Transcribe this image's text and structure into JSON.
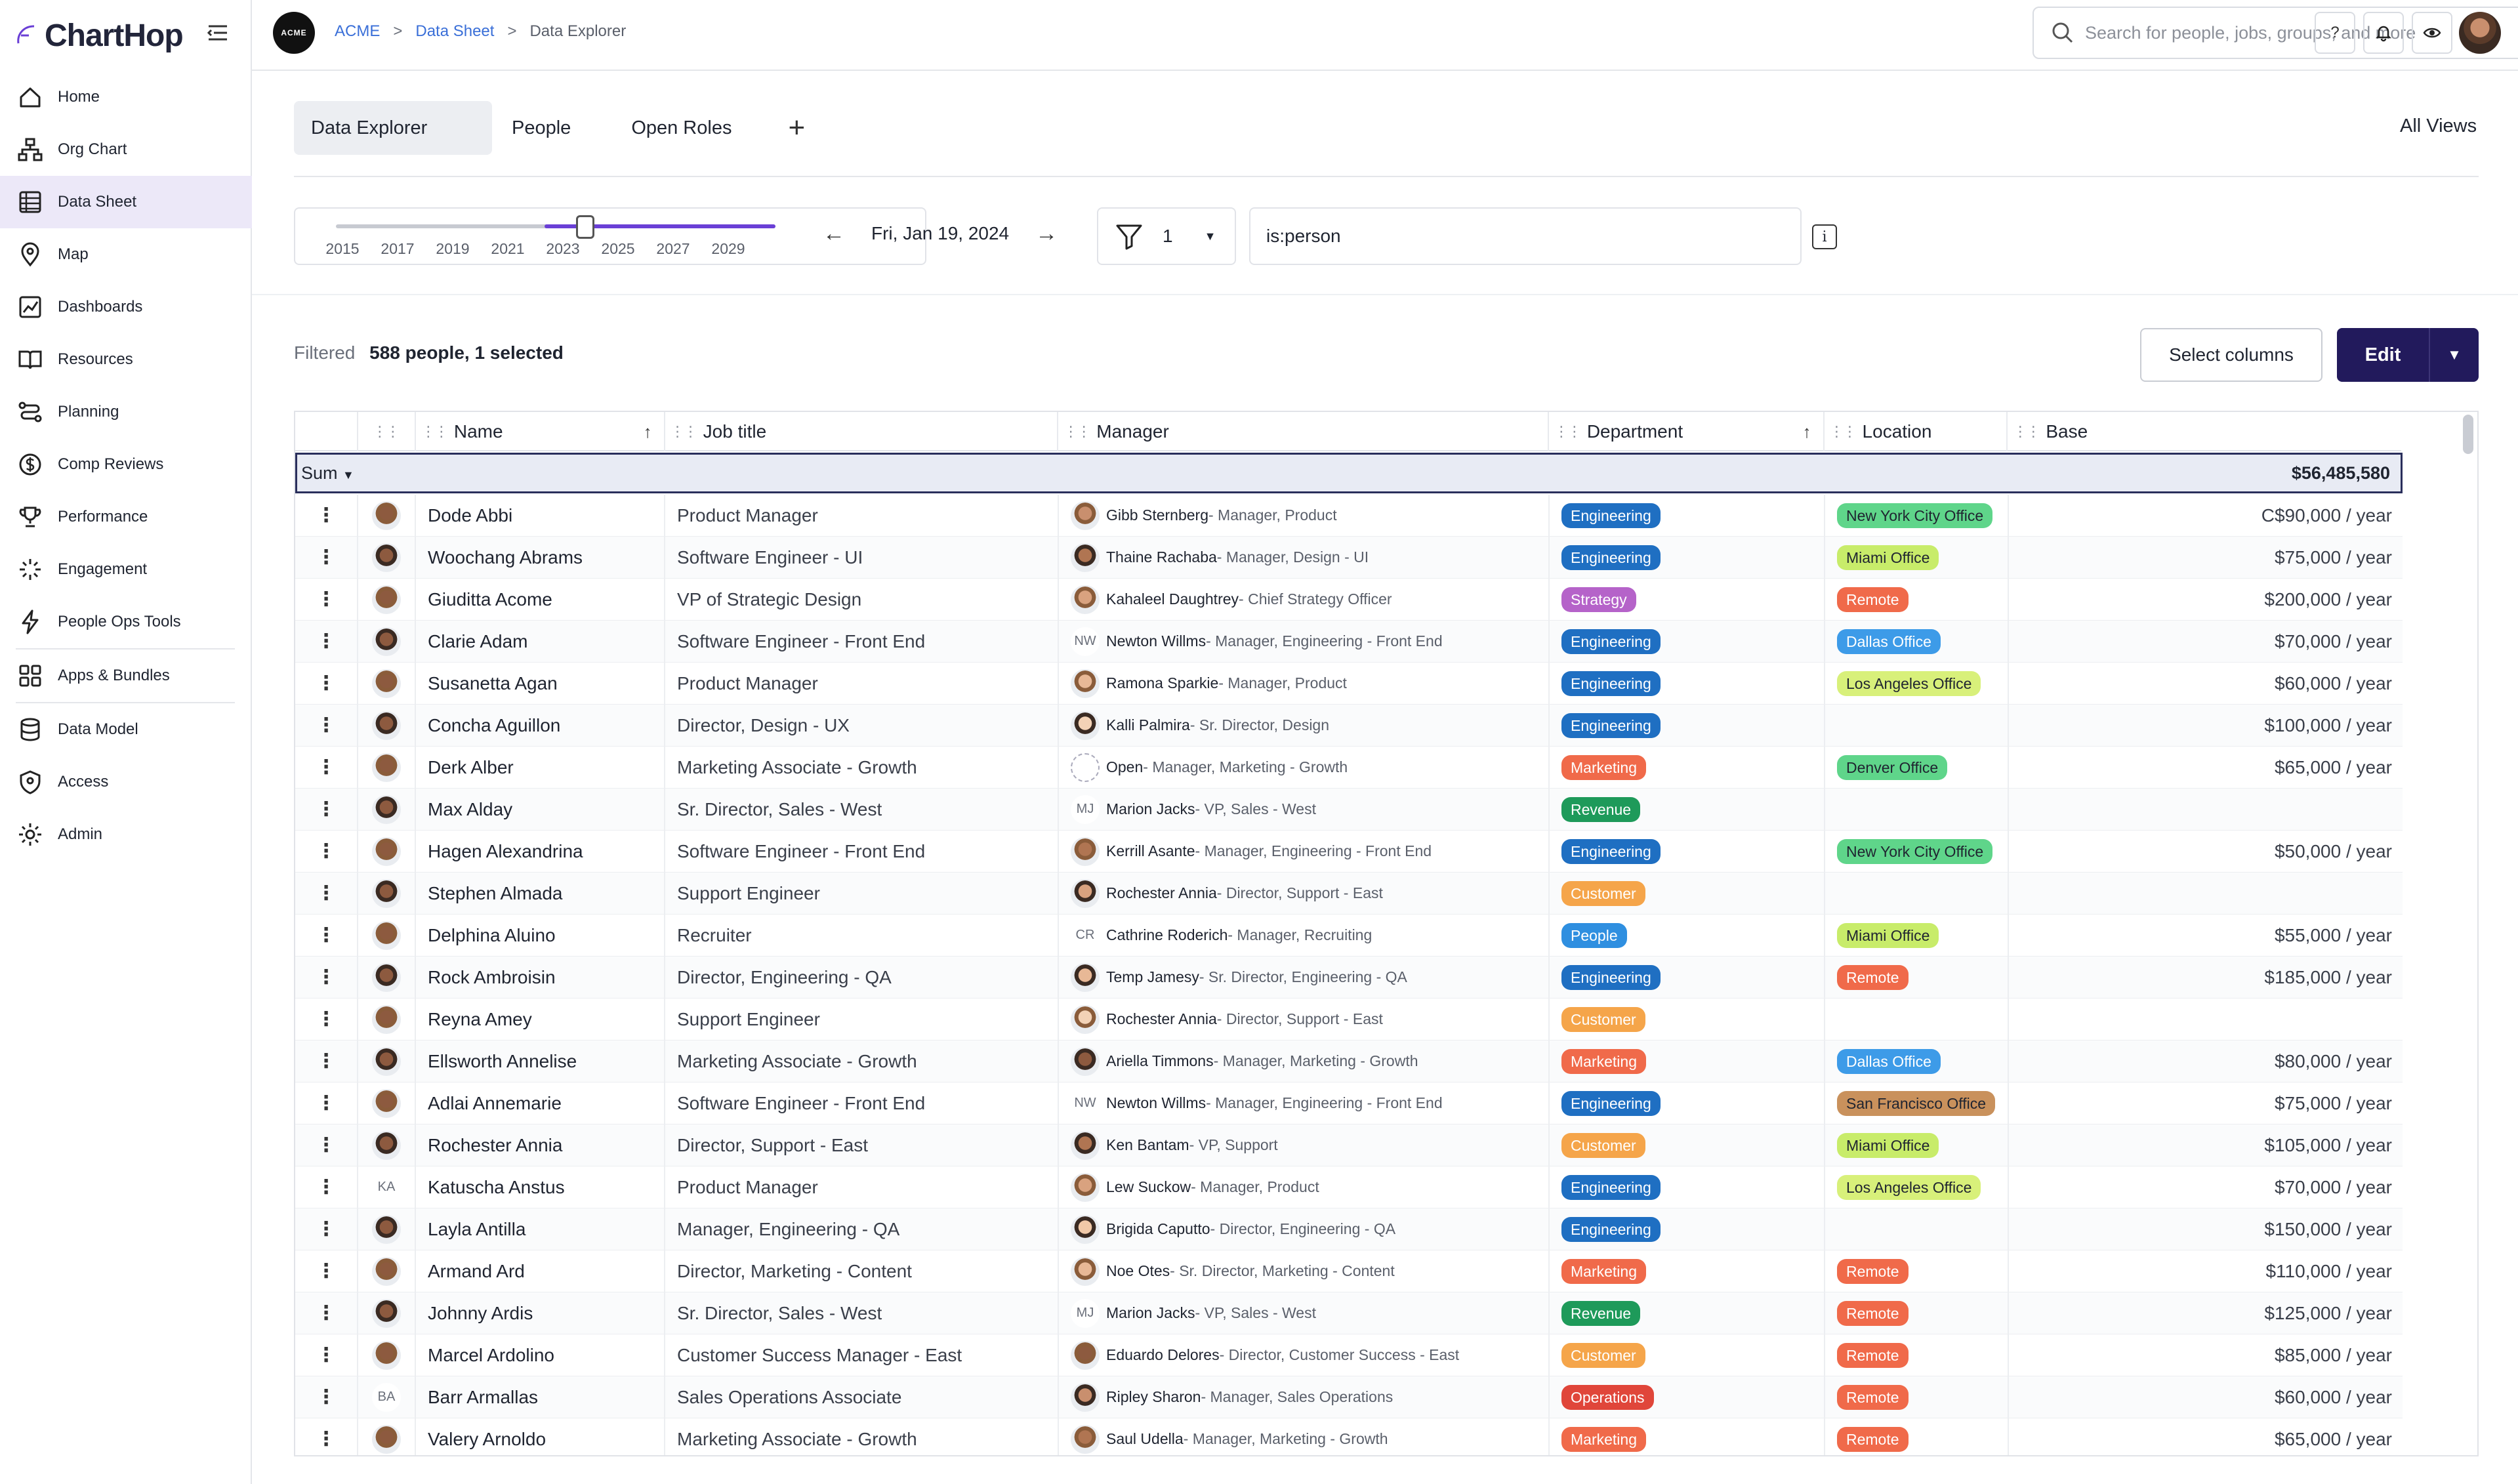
{
  "app": {
    "name": "ChartHop"
  },
  "sidebar": {
    "items": [
      {
        "label": "Home",
        "icon": "home-icon"
      },
      {
        "label": "Org Chart",
        "icon": "org-chart-icon"
      },
      {
        "label": "Data Sheet",
        "icon": "data-sheet-icon",
        "active": true
      },
      {
        "label": "Map",
        "icon": "map-pin-icon"
      },
      {
        "label": "Dashboards",
        "icon": "dashboard-icon"
      },
      {
        "label": "Resources",
        "icon": "book-icon"
      },
      {
        "label": "Planning",
        "icon": "planning-icon"
      },
      {
        "label": "Comp Reviews",
        "icon": "dollar-icon"
      },
      {
        "label": "Performance",
        "icon": "trophy-icon"
      },
      {
        "label": "Engagement",
        "icon": "engagement-icon"
      },
      {
        "label": "People Ops Tools",
        "icon": "bolt-icon"
      },
      {
        "label": "Apps & Bundles",
        "icon": "apps-icon"
      },
      {
        "label": "Data Model",
        "icon": "database-icon"
      },
      {
        "label": "Access",
        "icon": "shield-icon"
      },
      {
        "label": "Admin",
        "icon": "gear-icon"
      }
    ]
  },
  "topbar": {
    "org_logo": "ACME",
    "breadcrumb": [
      "ACME",
      "Data Sheet",
      "Data Explorer"
    ],
    "search_placeholder": "Search for people, jobs, groups, and more",
    "help": "?"
  },
  "tabs": [
    "Data Explorer",
    "People",
    "Open Roles"
  ],
  "all_views": "All Views",
  "timeline": {
    "years": [
      "2015",
      "2017",
      "2019",
      "2021",
      "2023",
      "2025",
      "2027",
      "2029"
    ],
    "date": "Fri, Jan 19, 2024"
  },
  "filter": {
    "count": "1",
    "query": "is:person"
  },
  "summary": {
    "label": "Filtered",
    "value": "588 people, 1 selected"
  },
  "actions": {
    "select_columns": "Select columns",
    "edit": "Edit"
  },
  "table": {
    "columns": [
      "Name",
      "Job title",
      "Manager",
      "Department",
      "Location",
      "Base"
    ],
    "sum_label": "Sum",
    "sum_value": "$56,485,580",
    "rows": [
      {
        "name": "Dode Abbi",
        "job": "Product Manager",
        "mgr": "Gibb Sternberg",
        "mgr_title": " - Manager, Product",
        "dept": "Engineering",
        "loc": "New York City Office",
        "base": "C$90,000 / year"
      },
      {
        "name": "Woochang Abrams",
        "job": "Software Engineer - UI",
        "mgr": "Thaine Rachaba",
        "mgr_title": " - Manager, Design - UI",
        "dept": "Engineering",
        "loc": "Miami Office",
        "base": "$75,000 / year"
      },
      {
        "name": "Giuditta Acome",
        "job": "VP of Strategic Design",
        "mgr": "Kahaleel Daughtrey",
        "mgr_title": " - Chief Strategy Officer",
        "dept": "Strategy",
        "loc": "Remote",
        "base": "$200,000 / year"
      },
      {
        "name": "Clarie Adam",
        "job": "Software Engineer - Front End",
        "mgr": "Newton Willms",
        "mgr_title": " - Manager, Engineering - Front End",
        "mgr_init": "NW",
        "dept": "Engineering",
        "loc": "Dallas Office",
        "base": "$70,000 / year"
      },
      {
        "name": "Susanetta Agan",
        "job": "Product Manager",
        "mgr": "Ramona Sparkie",
        "mgr_title": " - Manager, Product",
        "dept": "Engineering",
        "loc": "Los Angeles Office",
        "base": "$60,000 / year"
      },
      {
        "name": "Concha Aguillon",
        "job": "Director, Design - UX",
        "mgr": "Kalli Palmira",
        "mgr_title": " - Sr. Director, Design",
        "dept": "Engineering",
        "loc": "",
        "base": "$100,000 / year"
      },
      {
        "name": "Derk Alber",
        "job": "Marketing Associate - Growth",
        "mgr": "Open",
        "mgr_title": " - Manager, Marketing - Growth",
        "mgr_open": true,
        "dept": "Marketing",
        "loc": "Denver Office",
        "base": "$65,000 / year"
      },
      {
        "name": "Max Alday",
        "job": "Sr. Director, Sales - West",
        "mgr": "Marion Jacks",
        "mgr_title": " - VP, Sales - West",
        "mgr_init": "MJ",
        "dept": "Revenue",
        "loc": "",
        "base": ""
      },
      {
        "name": "Hagen Alexandrina",
        "job": "Software Engineer - Front End",
        "mgr": "Kerrill Asante",
        "mgr_title": " - Manager, Engineering - Front End",
        "dept": "Engineering",
        "loc": "New York City Office",
        "base": "$50,000 / year"
      },
      {
        "name": "Stephen Almada",
        "job": "Support Engineer",
        "mgr": "Rochester Annia",
        "mgr_title": " - Director, Support - East",
        "dept": "Customer",
        "loc": "",
        "base": ""
      },
      {
        "name": "Delphina Aluino",
        "job": "Recruiter",
        "mgr": "Cathrine Roderich",
        "mgr_title": " - Manager, Recruiting",
        "mgr_init": "CR",
        "dept": "People",
        "loc": "Miami Office",
        "base": "$55,000 / year"
      },
      {
        "name": "Rock Ambroisin",
        "job": "Director, Engineering - QA",
        "mgr": "Temp Jamesy",
        "mgr_title": " - Sr. Director, Engineering - QA",
        "dept": "Engineering",
        "loc": "Remote",
        "base": "$185,000 / year"
      },
      {
        "name": "Reyna Amey",
        "job": "Support Engineer",
        "mgr": "Rochester Annia",
        "mgr_title": " - Director, Support - East",
        "dept": "Customer",
        "loc": "",
        "base": ""
      },
      {
        "name": "Ellsworth Annelise",
        "job": "Marketing Associate - Growth",
        "mgr": "Ariella Timmons",
        "mgr_title": " - Manager, Marketing - Growth",
        "dept": "Marketing",
        "loc": "Dallas Office",
        "base": "$80,000 / year"
      },
      {
        "name": "Adlai Annemarie",
        "job": "Software Engineer - Front End",
        "mgr": "Newton Willms",
        "mgr_title": " - Manager, Engineering - Front End",
        "mgr_init": "NW",
        "dept": "Engineering",
        "loc": "San Francisco Office",
        "base": "$75,000 / year"
      },
      {
        "name": "Rochester Annia",
        "job": "Director, Support - East",
        "mgr": "Ken Bantam",
        "mgr_title": " - VP, Support",
        "dept": "Customer",
        "loc": "Miami Office",
        "base": "$105,000 / year"
      },
      {
        "name": "Katuscha Anstus",
        "job": "Product Manager",
        "init": "KA",
        "mgr": "Lew Suckow",
        "mgr_title": " - Manager, Product",
        "dept": "Engineering",
        "loc": "Los Angeles Office",
        "base": "$70,000 / year"
      },
      {
        "name": "Layla Antilla",
        "job": "Manager, Engineering - QA",
        "mgr": "Brigida Caputto",
        "mgr_title": " - Director, Engineering - QA",
        "dept": "Engineering",
        "loc": "",
        "base": "$150,000 / year"
      },
      {
        "name": "Armand Ard",
        "job": "Director, Marketing - Content",
        "mgr": "Noe Otes",
        "mgr_title": " - Sr. Director, Marketing - Content",
        "dept": "Marketing",
        "loc": "Remote",
        "base": "$110,000 / year"
      },
      {
        "name": "Johnny Ardis",
        "job": "Sr. Director, Sales - West",
        "mgr": "Marion Jacks",
        "mgr_title": " - VP, Sales - West",
        "mgr_init": "MJ",
        "dept": "Revenue",
        "loc": "Remote",
        "base": "$125,000 / year"
      },
      {
        "name": "Marcel Ardolino",
        "job": "Customer Success Manager - East",
        "mgr": "Eduardo Delores",
        "mgr_title": " - Director, Customer Success - East",
        "dept": "Customer",
        "loc": "Remote",
        "base": "$85,000 / year"
      },
      {
        "name": "Barr Armallas",
        "job": "Sales Operations Associate",
        "init": "BA",
        "mgr": "Ripley Sharon",
        "mgr_title": " - Manager, Sales Operations",
        "dept": "Operations",
        "loc": "Remote",
        "base": "$60,000 / year"
      },
      {
        "name": "Valery Arnoldo",
        "job": "Marketing Associate - Growth",
        "mgr": "Saul Udella",
        "mgr_title": " - Manager, Marketing - Growth",
        "dept": "Marketing",
        "loc": "Remote",
        "base": "$65,000 / year"
      }
    ]
  },
  "colors": {
    "accent": "#6a3fd6",
    "edit_button": "#221a5c",
    "dept": {
      "Engineering": "#1f6fc2",
      "Strategy": "#b563c9",
      "Marketing": "#f06a4a",
      "Revenue": "#1e9a5a",
      "Customer": "#f5a54a",
      "People": "#2f8fe0",
      "Operations": "#e0463a"
    },
    "loc": {
      "New York City Office": "#5fd58a",
      "Miami Office": "#c8ec6a",
      "Remote": "#f06a4a",
      "Dallas Office": "#3d9be8",
      "Los Angeles Office": "#d8f07a",
      "Denver Office": "#5fd58a",
      "San Francisco Office": "#c9915c"
    }
  }
}
